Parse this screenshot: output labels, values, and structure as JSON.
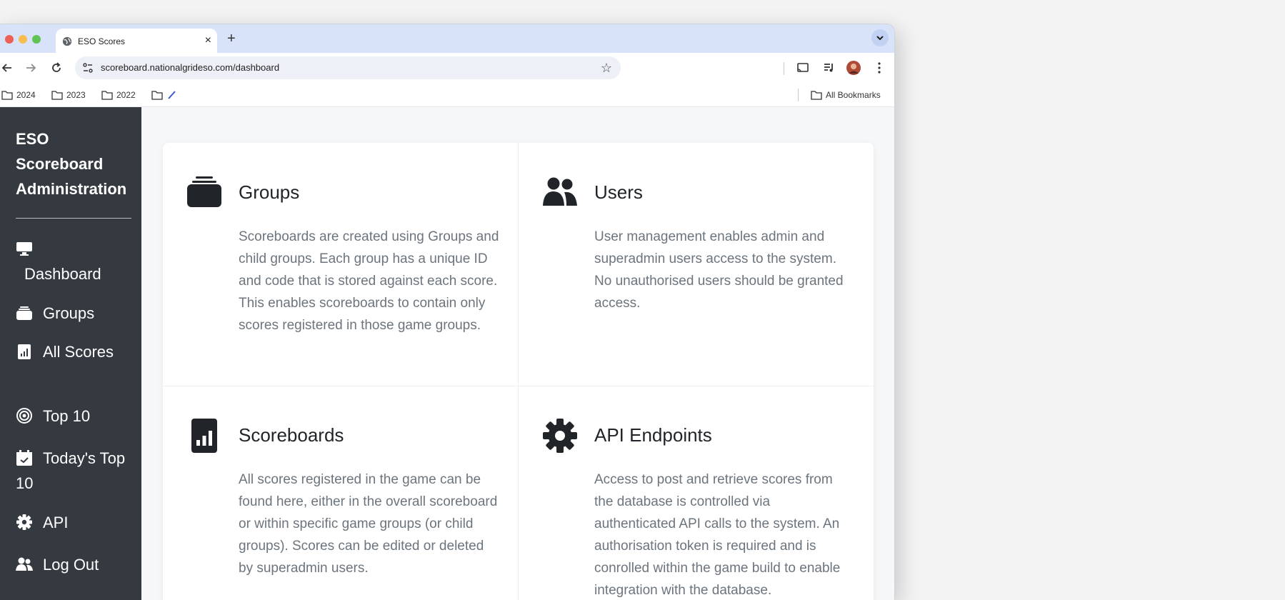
{
  "browser": {
    "tab_title": "ESO Scores",
    "new_tab": "+",
    "close": "×",
    "url": "scoreboard.nationalgrideso.com/dashboard",
    "bookmarks": [
      "2024",
      "2023",
      "2022",
      ""
    ],
    "all_bookmarks": "All Bookmarks"
  },
  "sidebar": {
    "brand": "ESO Scoreboard Administration",
    "items": [
      {
        "label": "Dashboard",
        "icon": "monitor-icon"
      },
      {
        "label": "Groups",
        "icon": "layers-icon"
      },
      {
        "label": "All Scores",
        "icon": "bar-chart-icon"
      },
      {
        "label": "Top 10",
        "icon": "target-icon"
      },
      {
        "label": "Today's Top 10",
        "icon": "calendar-check-icon"
      },
      {
        "label": "API",
        "icon": "gear-icon"
      },
      {
        "label": "Log Out",
        "icon": "users-icon"
      }
    ]
  },
  "features": [
    {
      "title": "Groups",
      "icon": "layers-icon",
      "description": "Scoreboards are created using Groups and child groups. Each group has a unique ID and code that is stored against each score. This enables scoreboards to contain only scores registered in those game groups."
    },
    {
      "title": "Users",
      "icon": "users-icon",
      "description": "User management enables admin and superadmin users access to the system. No unauthorised users should be granted access."
    },
    {
      "title": "Scoreboards",
      "icon": "bar-chart-icon",
      "description": "All scores registered in the game can be found here, either in the overall scoreboard or within specific game groups (or child groups). Scores can be edited or deleted by superadmin users."
    },
    {
      "title": "API Endpoints",
      "icon": "gear-icon",
      "description": "Access to post and retrieve scores from the database is controlled via authenticated API calls to the system. An authorisation token is required and is conrolled within the game build to enable integration with the database."
    }
  ],
  "colors": {
    "sidebar_bg": "#343a40",
    "tabstrip_bg": "#d8e3f9",
    "heading": "#212529",
    "muted_text": "#6c757d"
  }
}
